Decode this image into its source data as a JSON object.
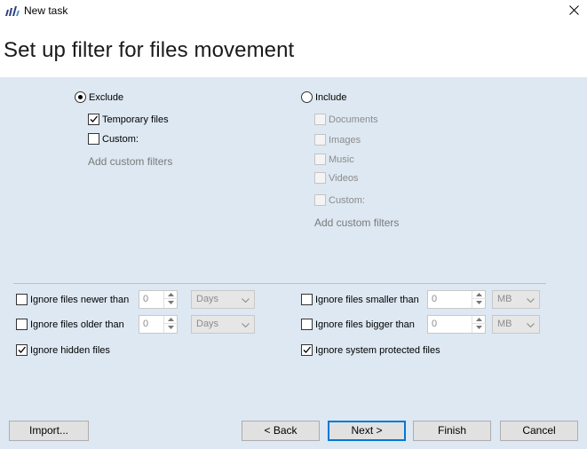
{
  "window": {
    "title": "New task",
    "close_icon": "close-icon",
    "app_icon": "app-logo-icon"
  },
  "header": {
    "heading": "Set up filter for files movement"
  },
  "exclude": {
    "label": "Exclude",
    "selected": true,
    "options": [
      {
        "label": "Temporary files",
        "checked": true
      },
      {
        "label": "Custom:",
        "checked": false
      }
    ],
    "add_custom": "Add custom filters"
  },
  "include": {
    "label": "Include",
    "selected": false,
    "options": [
      {
        "label": "Documents",
        "checked": false
      },
      {
        "label": "Images",
        "checked": false
      },
      {
        "label": "Music",
        "checked": false
      },
      {
        "label": "Videos",
        "checked": false
      },
      {
        "label": "Custom:",
        "checked": false
      }
    ],
    "add_custom": "Add custom filters"
  },
  "filters": {
    "newer": {
      "label": "Ignore files newer than",
      "checked": false,
      "value": "0",
      "unit": "Days"
    },
    "older": {
      "label": "Ignore files older than",
      "checked": false,
      "value": "0",
      "unit": "Days"
    },
    "hidden": {
      "label": "Ignore hidden files",
      "checked": true
    },
    "smaller": {
      "label": "Ignore files smaller than",
      "checked": false,
      "value": "0",
      "unit": "MB"
    },
    "bigger": {
      "label": "Ignore files bigger than",
      "checked": false,
      "value": "0",
      "unit": "MB"
    },
    "system": {
      "label": "Ignore system protected files",
      "checked": true
    }
  },
  "footer": {
    "import": "Import...",
    "back": "< Back",
    "next": "Next >",
    "finish": "Finish",
    "cancel": "Cancel"
  },
  "colors": {
    "body_bg": "#dde8f2",
    "accent": "#0078d7"
  }
}
